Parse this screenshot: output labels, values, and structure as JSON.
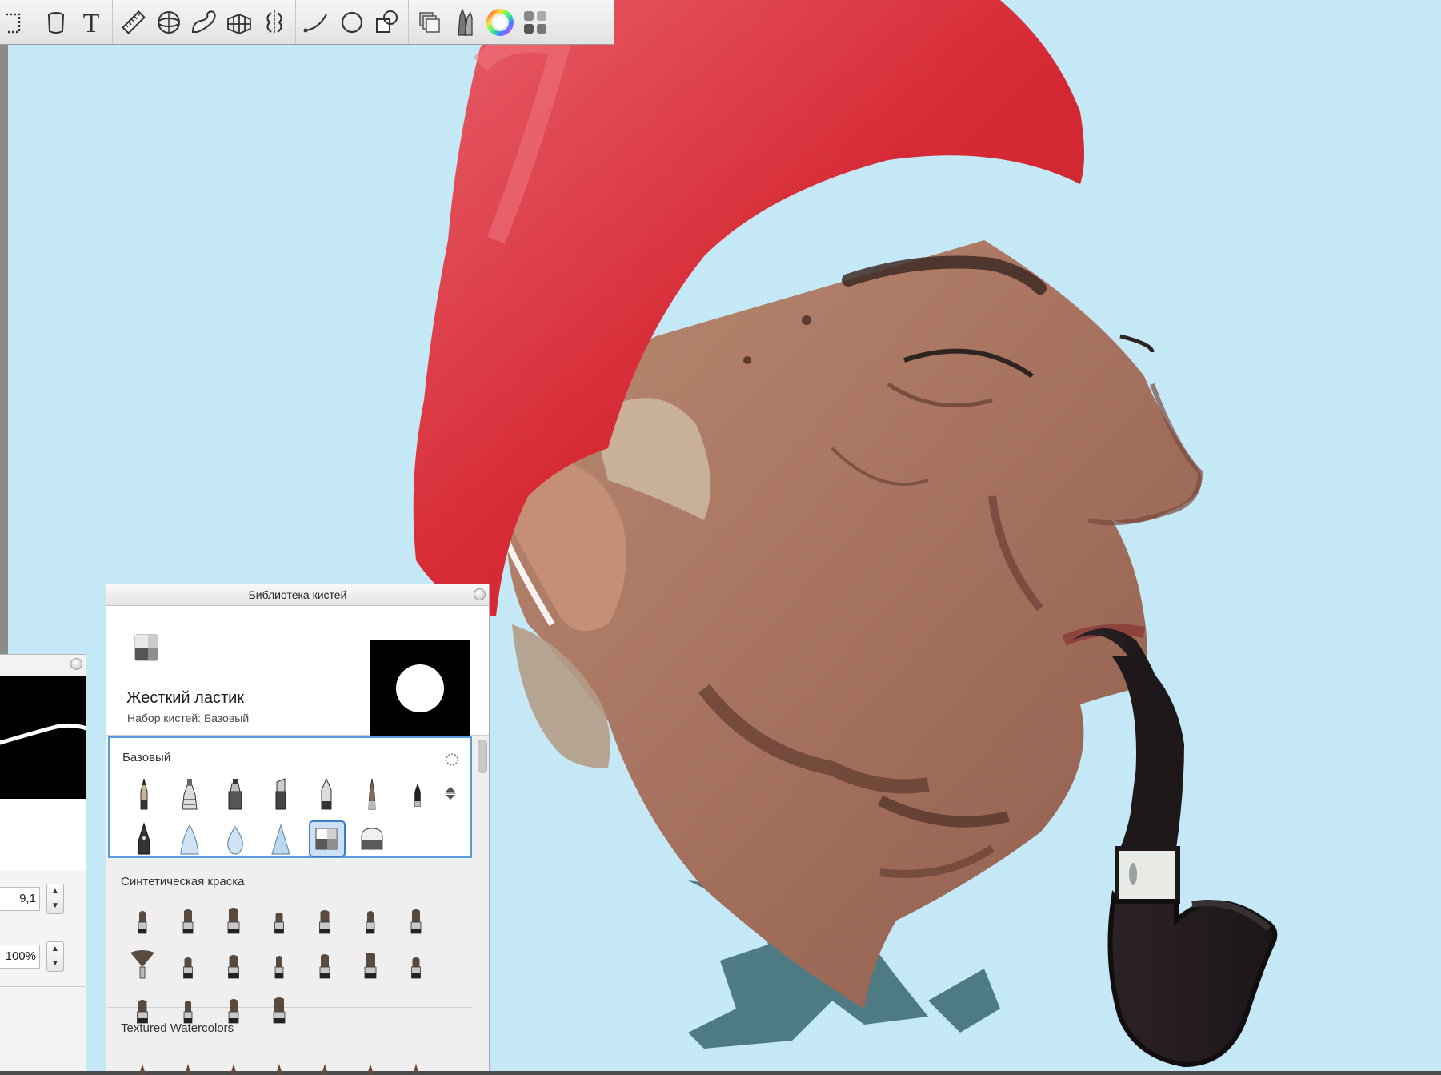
{
  "app": {
    "background_color": "#c4e8f5",
    "accent_color": "#3d7ec6"
  },
  "toolbar": {
    "items": [
      {
        "name": "selection-icon"
      },
      {
        "name": "fill-bucket-icon"
      },
      {
        "name": "text-icon",
        "glyph": "T"
      },
      {
        "name": "ruler-icon"
      },
      {
        "name": "ellipse-guide-icon"
      },
      {
        "name": "french-curve-icon"
      },
      {
        "name": "perspective-icon"
      },
      {
        "name": "symmetry-icon"
      },
      {
        "name": "stroke-line-icon"
      },
      {
        "name": "ellipse-icon"
      },
      {
        "name": "shapes-icon"
      },
      {
        "name": "layers-icon"
      },
      {
        "name": "brushes-icon"
      },
      {
        "name": "color-wheel-icon"
      },
      {
        "name": "swatches-icon"
      }
    ]
  },
  "brush_properties": {
    "size_value": "9,1",
    "opacity_value": "100%"
  },
  "brush_library": {
    "title": "Библиотека кистей",
    "current_brush": {
      "name": "Жесткий ластик",
      "set_label": "Набор кистей: Базовый"
    },
    "sets": [
      {
        "name": "Базовый",
        "active": true,
        "brushes": [
          {
            "name": "pencil-brush-icon"
          },
          {
            "name": "airbrush-icon"
          },
          {
            "name": "marker-icon"
          },
          {
            "name": "chisel-marker-icon"
          },
          {
            "name": "ballpoint-pen-icon"
          },
          {
            "name": "paintbrush-icon"
          },
          {
            "name": "felt-pen-icon"
          },
          {
            "name": "ink-pen-icon"
          },
          {
            "name": "smudge-icon"
          },
          {
            "name": "blur-drop-icon"
          },
          {
            "name": "sharpen-icon"
          },
          {
            "name": "hard-eraser-icon",
            "selected": true
          },
          {
            "name": "soft-eraser-icon"
          }
        ]
      },
      {
        "name": "Синтетическая краска",
        "active": false,
        "brushes": [
          {
            "name": "synthetic-brush-icon"
          },
          {
            "name": "synthetic-brush-icon"
          },
          {
            "name": "synthetic-brush-icon"
          },
          {
            "name": "synthetic-brush-icon"
          },
          {
            "name": "synthetic-brush-icon"
          },
          {
            "name": "synthetic-brush-icon"
          },
          {
            "name": "synthetic-brush-icon"
          },
          {
            "name": "fan-brush-icon"
          },
          {
            "name": "synthetic-brush-icon"
          },
          {
            "name": "synthetic-brush-icon"
          },
          {
            "name": "synthetic-brush-icon"
          },
          {
            "name": "synthetic-brush-icon"
          },
          {
            "name": "synthetic-brush-icon"
          },
          {
            "name": "synthetic-brush-icon"
          },
          {
            "name": "synthetic-brush-icon"
          },
          {
            "name": "synthetic-brush-icon"
          },
          {
            "name": "synthetic-brush-icon"
          },
          {
            "name": "synthetic-brush-icon"
          }
        ]
      },
      {
        "name": "Textured Watercolors",
        "active": false,
        "brushes": []
      }
    ]
  }
}
